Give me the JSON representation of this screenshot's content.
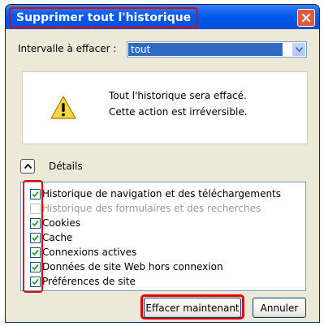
{
  "dialog": {
    "title": "Supprimer tout l'historique",
    "close_icon": "close-icon"
  },
  "range": {
    "label": "Intervalle à effacer :",
    "selected": "tout"
  },
  "warning": {
    "icon": "warning-icon",
    "line1": "Tout l'historique sera effacé.",
    "line2": "Cette action est irréversible."
  },
  "details": {
    "label": "Détails",
    "expanded": true
  },
  "items": [
    {
      "label": "Historique de navigation et des téléchargements",
      "checked": true,
      "enabled": true
    },
    {
      "label": "Historique des formulaires et des recherches",
      "checked": false,
      "enabled": false
    },
    {
      "label": "Cookies",
      "checked": true,
      "enabled": true
    },
    {
      "label": "Cache",
      "checked": true,
      "enabled": true
    },
    {
      "label": "Connexions actives",
      "checked": true,
      "enabled": true
    },
    {
      "label": "Données de site Web hors connexion",
      "checked": true,
      "enabled": true
    },
    {
      "label": "Préférences de site",
      "checked": true,
      "enabled": true
    }
  ],
  "buttons": {
    "clear": "Effacer maintenant",
    "cancel": "Annuler"
  },
  "colors": {
    "highlight": "#e00000",
    "titlebar": "#0058ee",
    "selection": "#316ac5"
  }
}
